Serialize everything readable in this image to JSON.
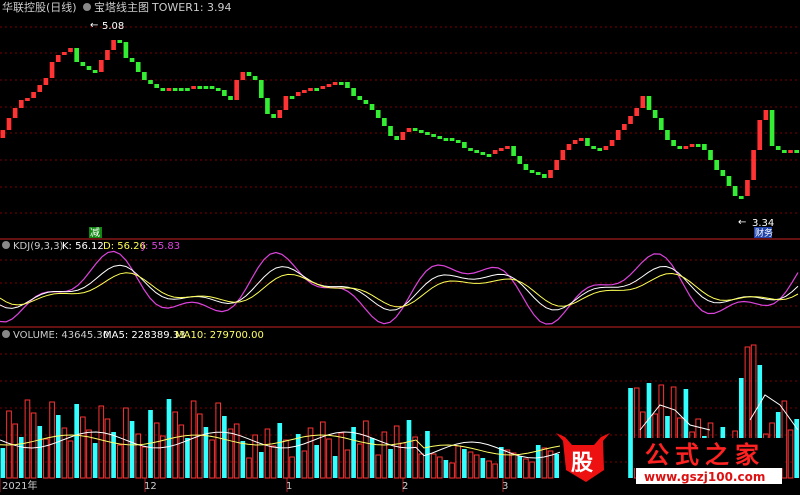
{
  "colors": {
    "up": "#ff3333",
    "down": "#33ee33",
    "grid": "#7a0000",
    "divider": "#cc2222",
    "k_line": "#ffffff",
    "d_line": "#ffff55",
    "j_line": "#dd44dd",
    "volume_up": "#ff3333",
    "volume_down": "#33ffff",
    "ma5": "#ffffff",
    "ma10": "#ffff66",
    "header_text": "#cccccc",
    "watermark_red": "#ee1111"
  },
  "header": {
    "stock_name": "华联控股(日线)",
    "indicator_name": "宝塔线主图",
    "tower_label": "TOWER1: 3.94"
  },
  "price_pane": {
    "high_label": "5.08",
    "low_label": "3.34",
    "tag_reduce": "减",
    "tag_finance": "财务"
  },
  "kdj_pane": {
    "title": "KDJ(9,3,3)",
    "k_text": "K: 56.12",
    "d_text": "D: 56.26",
    "j_text": "J: 55.83"
  },
  "volume_pane": {
    "title": "VOLUME: 43645.30",
    "ma5_text": "MA5: 228389.33",
    "ma10_text": "MA10: 279700.00"
  },
  "x_axis": {
    "labels": [
      "2021年",
      "12",
      "1",
      "2",
      "3"
    ]
  },
  "watermark": {
    "logo_char": "股",
    "title": "公式之家",
    "url": "www.gszj100.com"
  }
}
